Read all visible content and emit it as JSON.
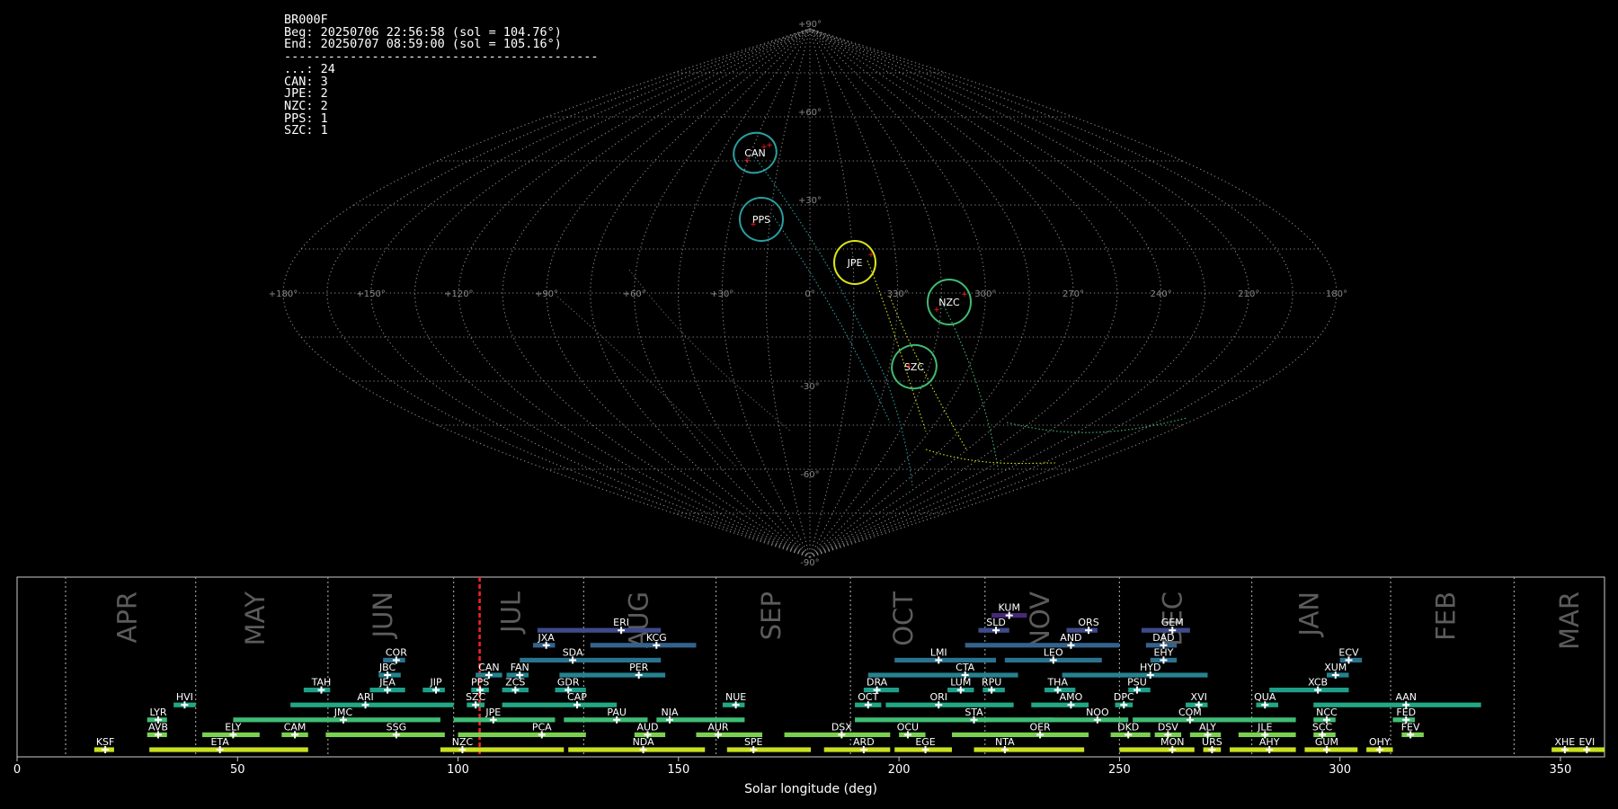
{
  "info_block": {
    "station": "BR000F",
    "begin": "Beg: 20250706 22:56:58 (sol = 104.76°)",
    "end": "End: 20250707 08:59:00 (sol = 105.16°)",
    "separator": "-------------------------------------------",
    "counts": [
      "...: 24",
      "CAN: 3",
      "JPE: 2",
      "NZC: 2",
      "PPS: 1",
      "SZC: 1"
    ]
  },
  "sky_map": {
    "projection": "sinusoidal",
    "lon_tick_labels": [
      "+180°",
      "+150°",
      "+120°",
      "+90°",
      "+60°",
      "+30°",
      "0°",
      "330°",
      "300°",
      "270°",
      "240°",
      "210°",
      "180°"
    ],
    "lat_tick_labels": [
      "+90°",
      "+60°",
      "+30°",
      "-30°",
      "-60°",
      "-90°"
    ],
    "showers": [
      {
        "code": "CAN",
        "color": "#2a9d9f"
      },
      {
        "code": "PPS",
        "color": "#2a9d9f"
      },
      {
        "code": "JPE",
        "color": "#dce319"
      },
      {
        "code": "NZC",
        "color": "#3fbc73"
      },
      {
        "code": "SZC",
        "color": "#3fbc73"
      }
    ]
  },
  "chart_data": {
    "type": "timeline",
    "xlabel": "Solar longitude (deg)",
    "xlim": [
      0,
      360
    ],
    "x_ticks": [
      0,
      50,
      100,
      150,
      200,
      250,
      300,
      350
    ],
    "month_labels": [
      {
        "name": "APR",
        "x": 25
      },
      {
        "name": "MAY",
        "x": 54
      },
      {
        "name": "JUN",
        "x": 83
      },
      {
        "name": "JUL",
        "x": 112
      },
      {
        "name": "AUG",
        "x": 141
      },
      {
        "name": "SEP",
        "x": 171
      },
      {
        "name": "OCT",
        "x": 201
      },
      {
        "name": "NOV",
        "x": 232
      },
      {
        "name": "DEC",
        "x": 262
      },
      {
        "name": "JAN",
        "x": 293
      },
      {
        "name": "FEB",
        "x": 324
      },
      {
        "name": "MAR",
        "x": 352
      }
    ],
    "month_boundaries": [
      11,
      40.5,
      70.5,
      99,
      128.5,
      158.5,
      189,
      219.5,
      250,
      280,
      311.5,
      339.5
    ],
    "current_sol": 104.9,
    "showers": [
      {
        "code": "KSF",
        "start": 17.5,
        "end": 22,
        "peak": 20,
        "level": 0,
        "color": "#c8e020"
      },
      {
        "code": "ETA",
        "start": 30,
        "end": 66,
        "peak": 46,
        "level": 0,
        "color": "#c8e020"
      },
      {
        "code": "NZC",
        "start": 96,
        "end": 124,
        "peak": 101,
        "level": 0,
        "color": "#c8e020"
      },
      {
        "code": "NDA",
        "start": 125,
        "end": 156,
        "peak": 142,
        "level": 0,
        "color": "#c8e020"
      },
      {
        "code": "SPE",
        "start": 161,
        "end": 180,
        "peak": 167,
        "level": 0,
        "color": "#c8e020"
      },
      {
        "code": "ARD",
        "start": 183,
        "end": 198,
        "peak": 192,
        "level": 0,
        "color": "#c8e020"
      },
      {
        "code": "EGE",
        "start": 199,
        "end": 212,
        "peak": 206,
        "level": 0,
        "color": "#c8e020"
      },
      {
        "code": "NTA",
        "start": 217,
        "end": 242,
        "peak": 224,
        "level": 0,
        "color": "#c8e020"
      },
      {
        "code": "MON",
        "start": 250,
        "end": 267,
        "peak": 262,
        "level": 0,
        "color": "#c8e020"
      },
      {
        "code": "URS",
        "start": 269,
        "end": 273,
        "peak": 271,
        "level": 0,
        "color": "#c8e020"
      },
      {
        "code": "AHY",
        "start": 275,
        "end": 290,
        "peak": 284,
        "level": 0,
        "color": "#c8e020"
      },
      {
        "code": "GUM",
        "start": 292,
        "end": 304,
        "peak": 297,
        "level": 0,
        "color": "#c8e020"
      },
      {
        "code": "OHY",
        "start": 306,
        "end": 312,
        "peak": 309,
        "level": 0,
        "color": "#c8e020"
      },
      {
        "code": "XHE",
        "start": 348,
        "end": 355,
        "peak": 351,
        "level": 0,
        "color": "#c8e020"
      },
      {
        "code": "EVI",
        "start": 354,
        "end": 360,
        "peak": 356,
        "level": 0,
        "color": "#c8e020"
      },
      {
        "code": "AVB",
        "start": 29.5,
        "end": 34,
        "peak": 32,
        "level": 1,
        "color": "#7ad151"
      },
      {
        "code": "ELY",
        "start": 42,
        "end": 55,
        "peak": 49,
        "level": 1,
        "color": "#7ad151"
      },
      {
        "code": "CAM",
        "start": 60,
        "end": 66,
        "peak": 63,
        "level": 1,
        "color": "#7ad151"
      },
      {
        "code": "SSG",
        "start": 70,
        "end": 97,
        "peak": 86,
        "level": 1,
        "color": "#7ad151"
      },
      {
        "code": "PCA",
        "start": 100,
        "end": 129,
        "peak": 119,
        "level": 1,
        "color": "#7ad151"
      },
      {
        "code": "AUD",
        "start": 140,
        "end": 147,
        "peak": 143,
        "level": 1,
        "color": "#7ad151"
      },
      {
        "code": "AUR",
        "start": 154,
        "end": 169,
        "peak": 159,
        "level": 1,
        "color": "#7ad151"
      },
      {
        "code": "DSX",
        "start": 174,
        "end": 198,
        "peak": 187,
        "level": 1,
        "color": "#7ad151"
      },
      {
        "code": "OCU",
        "start": 200,
        "end": 206,
        "peak": 202,
        "level": 1,
        "color": "#7ad151"
      },
      {
        "code": "OER",
        "start": 212,
        "end": 243,
        "peak": 232,
        "level": 1,
        "color": "#7ad151"
      },
      {
        "code": "DKD",
        "start": 248,
        "end": 257,
        "peak": 252,
        "level": 1,
        "color": "#7ad151"
      },
      {
        "code": "DSV",
        "start": 258,
        "end": 264,
        "peak": 261,
        "level": 1,
        "color": "#7ad151"
      },
      {
        "code": "ALY",
        "start": 266,
        "end": 273,
        "peak": 270,
        "level": 1,
        "color": "#7ad151"
      },
      {
        "code": "JLE",
        "start": 277,
        "end": 290,
        "peak": 283,
        "level": 1,
        "color": "#7ad151"
      },
      {
        "code": "SCC",
        "start": 294,
        "end": 299,
        "peak": 296,
        "level": 1,
        "color": "#7ad151"
      },
      {
        "code": "FEV",
        "start": 314,
        "end": 319,
        "peak": 316,
        "level": 1,
        "color": "#7ad151"
      },
      {
        "code": "LYR",
        "start": 29.5,
        "end": 34,
        "peak": 32,
        "level": 2,
        "color": "#3fbc73"
      },
      {
        "code": "JMC",
        "start": 49,
        "end": 96,
        "peak": 74,
        "level": 2,
        "color": "#3fbc73"
      },
      {
        "code": "JPE",
        "start": 99,
        "end": 122,
        "peak": 108,
        "level": 2,
        "color": "#3fbc73"
      },
      {
        "code": "PAU",
        "start": 124,
        "end": 143,
        "peak": 136,
        "level": 2,
        "color": "#3fbc73"
      },
      {
        "code": "NIA",
        "start": 145,
        "end": 165,
        "peak": 148,
        "level": 2,
        "color": "#3fbc73"
      },
      {
        "code": "STA",
        "start": 190,
        "end": 235,
        "peak": 217,
        "level": 2,
        "color": "#3fbc73"
      },
      {
        "code": "NOO",
        "start": 232,
        "end": 252,
        "peak": 245,
        "level": 2,
        "color": "#3fbc73"
      },
      {
        "code": "COM",
        "start": 253,
        "end": 290,
        "peak": 266,
        "level": 2,
        "color": "#3fbc73"
      },
      {
        "code": "NCC",
        "start": 294,
        "end": 299,
        "peak": 297,
        "level": 2,
        "color": "#3fbc73"
      },
      {
        "code": "FED",
        "start": 312,
        "end": 317,
        "peak": 315,
        "level": 2,
        "color": "#3fbc73"
      },
      {
        "code": "HVI",
        "start": 35.5,
        "end": 40.5,
        "peak": 38,
        "level": 3,
        "color": "#22a884"
      },
      {
        "code": "ARI",
        "start": 62,
        "end": 99,
        "peak": 79,
        "level": 3,
        "color": "#22a884"
      },
      {
        "code": "SZC",
        "start": 102,
        "end": 106,
        "peak": 104,
        "level": 3,
        "color": "#22a884"
      },
      {
        "code": "CAP",
        "start": 110,
        "end": 136,
        "peak": 127,
        "level": 3,
        "color": "#22a884"
      },
      {
        "code": "NUE",
        "start": 160,
        "end": 165,
        "peak": 163,
        "level": 3,
        "color": "#22a884"
      },
      {
        "code": "OCT",
        "start": 190,
        "end": 196,
        "peak": 193,
        "level": 3,
        "color": "#22a884"
      },
      {
        "code": "ORI",
        "start": 197,
        "end": 226,
        "peak": 209,
        "level": 3,
        "color": "#22a884"
      },
      {
        "code": "AMO",
        "start": 230,
        "end": 243,
        "peak": 239,
        "level": 3,
        "color": "#22a884"
      },
      {
        "code": "DPC",
        "start": 249,
        "end": 253,
        "peak": 251,
        "level": 3,
        "color": "#22a884"
      },
      {
        "code": "XVI",
        "start": 265,
        "end": 270,
        "peak": 268,
        "level": 3,
        "color": "#22a884"
      },
      {
        "code": "QUA",
        "start": 281,
        "end": 286,
        "peak": 283,
        "level": 3,
        "color": "#22a884"
      },
      {
        "code": "AAN",
        "start": 294,
        "end": 332,
        "peak": 315,
        "level": 3,
        "color": "#22a884"
      },
      {
        "code": "TAH",
        "start": 65,
        "end": 71,
        "peak": 69,
        "level": 4,
        "color": "#1f9e89"
      },
      {
        "code": "JEA",
        "start": 80,
        "end": 88,
        "peak": 84,
        "level": 4,
        "color": "#1f9e89"
      },
      {
        "code": "JIP",
        "start": 92,
        "end": 97,
        "peak": 95,
        "level": 4,
        "color": "#1f9e89"
      },
      {
        "code": "PPS",
        "start": 103,
        "end": 107,
        "peak": 105,
        "level": 4,
        "color": "#1f9e89"
      },
      {
        "code": "ZCS",
        "start": 110,
        "end": 116,
        "peak": 113,
        "level": 4,
        "color": "#1f9e89"
      },
      {
        "code": "GDR",
        "start": 122,
        "end": 129,
        "peak": 125,
        "level": 4,
        "color": "#1f9e89"
      },
      {
        "code": "DRA",
        "start": 192,
        "end": 200,
        "peak": 195,
        "level": 4,
        "color": "#1f9e89"
      },
      {
        "code": "LUM",
        "start": 211,
        "end": 217,
        "peak": 214,
        "level": 4,
        "color": "#1f9e89"
      },
      {
        "code": "RPU",
        "start": 219,
        "end": 224,
        "peak": 221,
        "level": 4,
        "color": "#1f9e89"
      },
      {
        "code": "THA",
        "start": 233,
        "end": 240,
        "peak": 236,
        "level": 4,
        "color": "#1f9e89"
      },
      {
        "code": "PSU",
        "start": 252,
        "end": 257,
        "peak": 254,
        "level": 4,
        "color": "#1f9e89"
      },
      {
        "code": "XCB",
        "start": 284,
        "end": 302,
        "peak": 295,
        "level": 4,
        "color": "#1f9e89"
      },
      {
        "code": "JBC",
        "start": 82,
        "end": 87,
        "peak": 84,
        "level": 5,
        "color": "#26828e"
      },
      {
        "code": "CAN",
        "start": 104,
        "end": 110,
        "peak": 107,
        "level": 5,
        "color": "#26828e"
      },
      {
        "code": "FAN",
        "start": 111,
        "end": 116,
        "peak": 114,
        "level": 5,
        "color": "#26828e"
      },
      {
        "code": "PER",
        "start": 123,
        "end": 147,
        "peak": 141,
        "level": 5,
        "color": "#26828e"
      },
      {
        "code": "CTA",
        "start": 193,
        "end": 227,
        "peak": 215,
        "level": 5,
        "color": "#26828e"
      },
      {
        "code": "HYD",
        "start": 237,
        "end": 270,
        "peak": 257,
        "level": 5,
        "color": "#26828e"
      },
      {
        "code": "XUM",
        "start": 297,
        "end": 302,
        "peak": 299,
        "level": 5,
        "color": "#26828e"
      },
      {
        "code": "COR",
        "start": 83,
        "end": 88,
        "peak": 86,
        "level": 6,
        "color": "#2c728e"
      },
      {
        "code": "SDA",
        "start": 114,
        "end": 146,
        "peak": 126,
        "level": 6,
        "color": "#2c728e"
      },
      {
        "code": "LMI",
        "start": 199,
        "end": 222,
        "peak": 209,
        "level": 6,
        "color": "#2c728e"
      },
      {
        "code": "LEO",
        "start": 224,
        "end": 246,
        "peak": 235,
        "level": 6,
        "color": "#2c728e"
      },
      {
        "code": "EHY",
        "start": 257,
        "end": 263,
        "peak": 260,
        "level": 6,
        "color": "#2c728e"
      },
      {
        "code": "ECV",
        "start": 300,
        "end": 305,
        "peak": 302,
        "level": 6,
        "color": "#2c728e"
      },
      {
        "code": "JXA",
        "start": 117,
        "end": 122,
        "peak": 120,
        "level": 7,
        "color": "#33638d"
      },
      {
        "code": "KCG",
        "start": 130,
        "end": 154,
        "peak": 145,
        "level": 7,
        "color": "#33638d"
      },
      {
        "code": "AND",
        "start": 215,
        "end": 250,
        "peak": 239,
        "level": 7,
        "color": "#33638d"
      },
      {
        "code": "DAD",
        "start": 256,
        "end": 263,
        "peak": 260,
        "level": 7,
        "color": "#33638d"
      },
      {
        "code": "ERI",
        "start": 118,
        "end": 146,
        "peak": 137,
        "level": 8,
        "color": "#3e4a89"
      },
      {
        "code": "SLD",
        "start": 218,
        "end": 225,
        "peak": 222,
        "level": 8,
        "color": "#3e4a89"
      },
      {
        "code": "ORS",
        "start": 238,
        "end": 245,
        "peak": 243,
        "level": 8,
        "color": "#3e4a89"
      },
      {
        "code": "GEM",
        "start": 255,
        "end": 266,
        "peak": 262,
        "level": 8,
        "color": "#3e4a89"
      },
      {
        "code": "KUM",
        "start": 221,
        "end": 229,
        "peak": 225,
        "level": 9,
        "color": "#482878"
      }
    ]
  }
}
